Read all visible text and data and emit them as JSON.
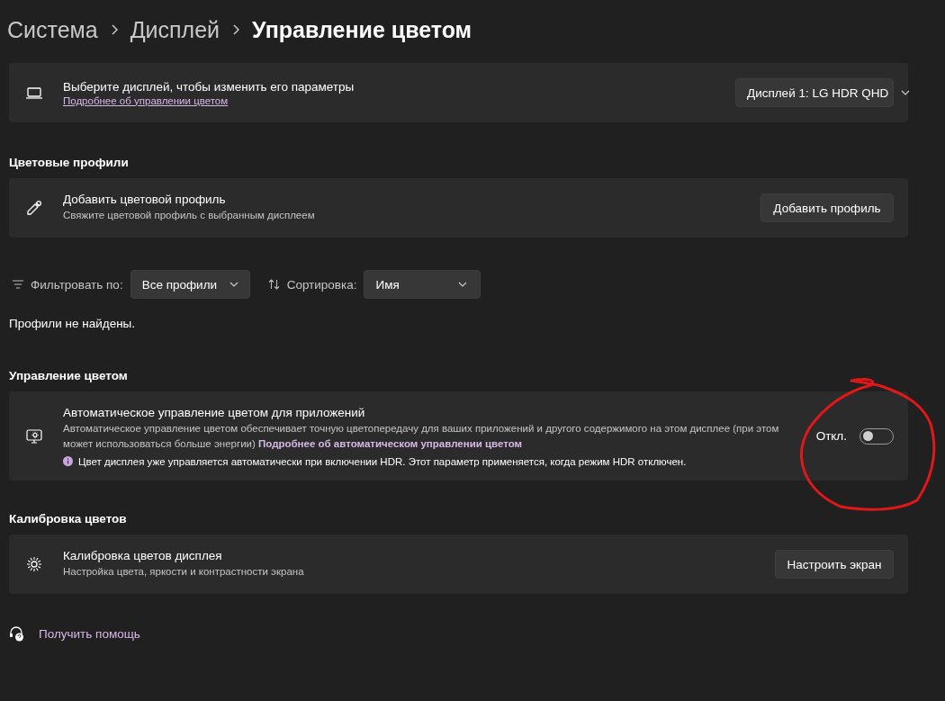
{
  "breadcrumb": [
    {
      "label": "Система",
      "selected": false
    },
    {
      "label": "Дисплей",
      "selected": false
    },
    {
      "label": "Управление цветом",
      "selected": true
    }
  ],
  "display_card": {
    "title": "Выберите дисплей, чтобы изменить его параметры",
    "link": "Подробнее об управлении цветом",
    "dropdown": "Дисплей 1: LG HDR QHD"
  },
  "color_profiles": {
    "heading": "Цветовые профили",
    "card": {
      "title": "Добавить цветовой профиль",
      "description": "Свяжите цветовой профиль с выбранным дисплеем",
      "button": "Добавить профиль"
    },
    "filter": {
      "label": "Фильтровать по:",
      "value": "Все профили"
    },
    "sort": {
      "label": "Сортировка:",
      "value": "Имя"
    },
    "empty_message": "Профили не найдены."
  },
  "color_management": {
    "heading": "Управление цветом",
    "card": {
      "title": "Автоматическое управление цветом для приложений",
      "description": "Автоматическое управление цветом обеспечивает точную цветопередачу для ваших приложений и другого содержимого на этом дисплее (при этом может использоваться больше энергии)",
      "link": "Подробнее об автоматическом управлении цветом",
      "info": "Цвет дисплея уже управляется автоматически при включении HDR. Этот параметр применяется, когда режим HDR отключен.",
      "toggle": {
        "label": "Откл.",
        "on": false
      }
    }
  },
  "calibration": {
    "heading": "Калибровка цветов",
    "card": {
      "title": "Калибровка цветов дисплея",
      "description": "Настройка цвета, яркости и контрастности экрана",
      "button": "Настроить экран"
    }
  },
  "help_link": "Получить помощь"
}
